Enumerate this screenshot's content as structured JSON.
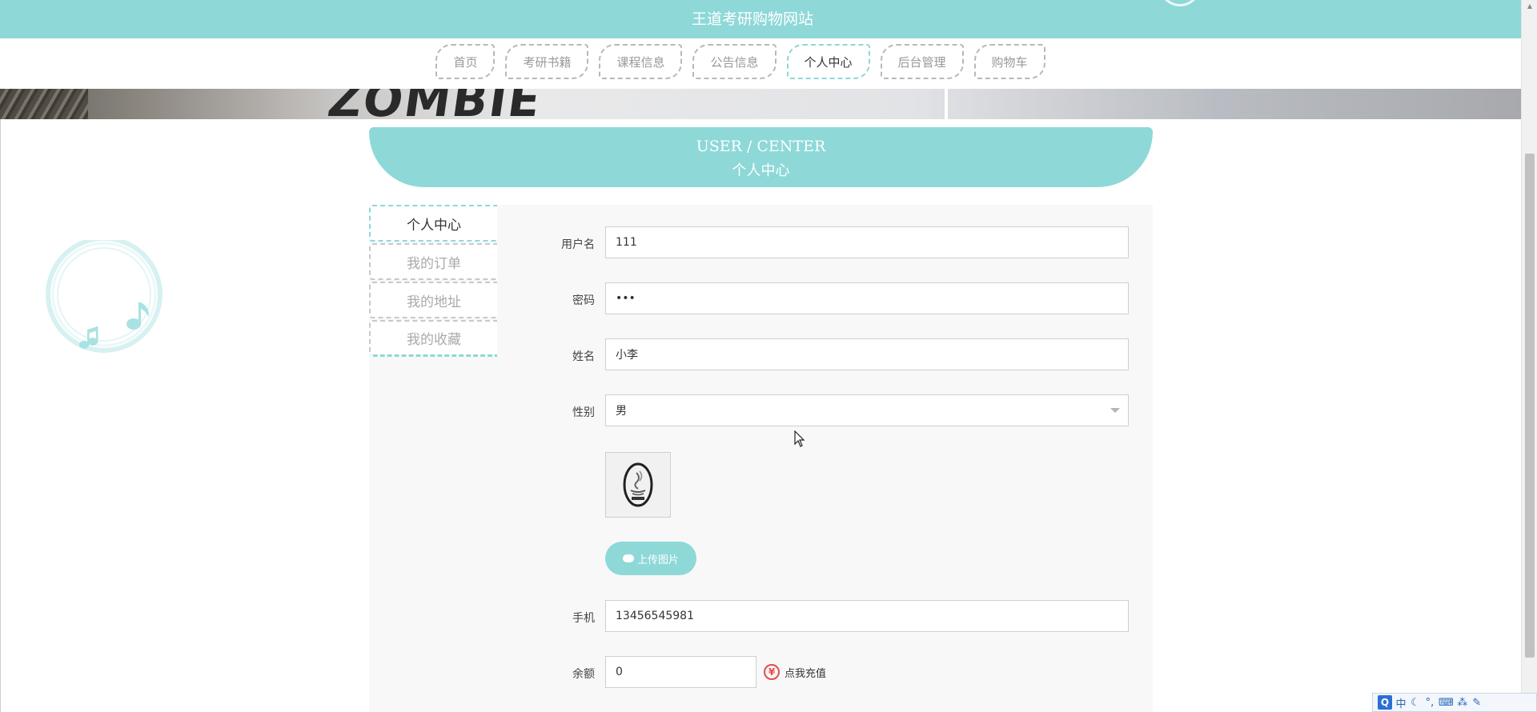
{
  "site": {
    "title": "王道考研购物网站"
  },
  "nav": {
    "items": [
      {
        "label": "首页",
        "active": false
      },
      {
        "label": "考研书籍",
        "active": false
      },
      {
        "label": "课程信息",
        "active": false
      },
      {
        "label": "公告信息",
        "active": false
      },
      {
        "label": "个人中心",
        "active": true
      },
      {
        "label": "后台管理",
        "active": false
      },
      {
        "label": "购物车",
        "active": false
      }
    ]
  },
  "banner": {
    "text": "ZOMBIE"
  },
  "user_center": {
    "title_en": "USER / CENTER",
    "title_cn": "个人中心"
  },
  "side_menu": {
    "items": [
      {
        "label": "个人中心",
        "active": true
      },
      {
        "label": "我的订单",
        "active": false
      },
      {
        "label": "我的地址",
        "active": false
      },
      {
        "label": "我的收藏",
        "active": false
      }
    ]
  },
  "form": {
    "username": {
      "label": "用户名",
      "value": "111"
    },
    "password": {
      "label": "密码",
      "value": "•••"
    },
    "name": {
      "label": "姓名",
      "value": "小李"
    },
    "gender": {
      "label": "性别",
      "value": "男"
    },
    "avatar": {
      "alt": "java-logo"
    },
    "upload": {
      "label": "上传图片"
    },
    "phone": {
      "label": "手机",
      "value": "13456545981"
    },
    "balance": {
      "label": "余额",
      "value": "0"
    },
    "recharge": {
      "label": "点我充值",
      "symbol": "¥"
    }
  },
  "ime": {
    "logo": "Q",
    "mode": "中",
    "items": [
      "☾",
      "°,",
      "⌨",
      "⁂",
      "✎"
    ]
  },
  "colors": {
    "accent": "#8ed8d8",
    "recharge": "#e74c4c",
    "ime_blue": "#2b6fd6"
  }
}
